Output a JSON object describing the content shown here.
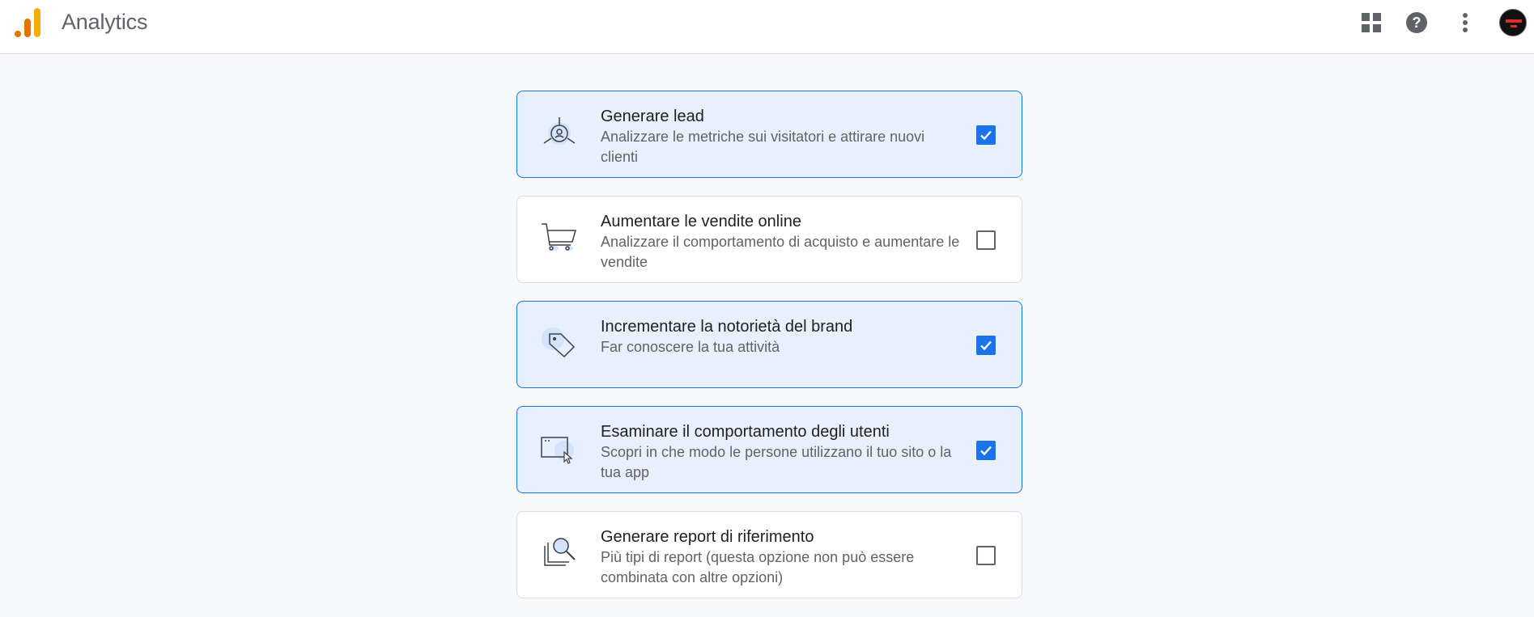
{
  "app": {
    "title": "Analytics",
    "logo_colors": [
      "#e37400",
      "#f9ab00",
      "#f9ab00"
    ]
  },
  "toolbar": {
    "apps_icon": "apps-grid-icon",
    "help_icon": "help-icon",
    "more_icon": "more-vert-icon",
    "avatar": "avatar-icon"
  },
  "colors": {
    "accent": "#1a73e8",
    "selected_bg": "#e8f0fe"
  },
  "objectives": [
    {
      "title": "Generare lead",
      "description": "Analizzare le metriche sui visitatori e attirare nuovi clienti",
      "icon": "lead-target-icon",
      "checked": true
    },
    {
      "title": "Aumentare le vendite online",
      "description": "Analizzare il comportamento di acquisto e aumentare le vendite",
      "icon": "shopping-cart-icon",
      "checked": false
    },
    {
      "title": "Incrementare la notorietà del brand",
      "description": "Far conoscere la tua attività",
      "icon": "price-tag-icon",
      "checked": true
    },
    {
      "title": "Esaminare il comportamento degli utenti",
      "description": "Scopri in che modo le persone utilizzano il tuo sito o la tua app",
      "icon": "browser-cursor-icon",
      "checked": true
    },
    {
      "title": "Generare report di riferimento",
      "description": "Più tipi di report (questa opzione non può essere combinata con altre opzioni)",
      "icon": "report-magnifier-icon",
      "checked": false
    }
  ]
}
